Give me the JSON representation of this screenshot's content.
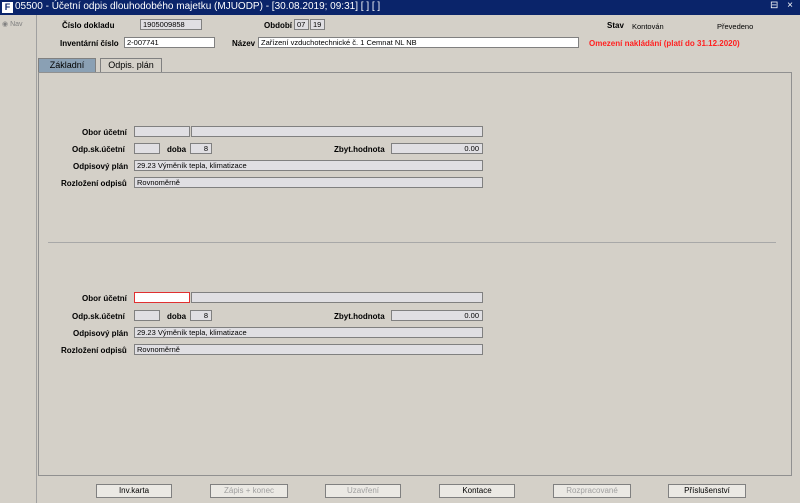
{
  "titlebar": {
    "icon": "F",
    "title": "05500 - Účetní odpis dlouhodobého majetku (MJUODP) - [30.08.2019; 09:31]  [ ]  [ ]",
    "controls": "⊟ ×"
  },
  "nav": {
    "label": "Nav"
  },
  "header": {
    "doc_number_label": "Číslo dokladu",
    "doc_number_value": "1905009858",
    "period_label": "Období",
    "period_month": "07",
    "period_year": "19",
    "state_label": "Stav",
    "state_value": "Kontován",
    "state_value2": "Převedeno",
    "inventory_label": "Inventární číslo",
    "inventory_value": "2-007741",
    "name_label": "Název",
    "name_value": "Zařízení vzduchotechnické č. 1 Cemnat NL NB",
    "restriction_text": "Omezení nakládání (platí do 31.12.2020)"
  },
  "tabs": [
    {
      "label": "Základní"
    },
    {
      "label": "Odpis. plán"
    }
  ],
  "sections": [
    {
      "obor_label": "Obor účetní",
      "obor_code": "",
      "obor_name": "",
      "odp_label": "Odp.sk.účetní",
      "odp_value": "",
      "doba_label": "doba",
      "doba_value": "8",
      "zbyt_label": "Zbyt.hodnota",
      "zbyt_value": "0.00",
      "plan_label": "Odpisový plán",
      "plan_value": "29.23 Výměník tepla, klimatizace",
      "rozlozeni_label": "Rozložení odpisů",
      "rozlozeni_value": "Rovnoměrně"
    },
    {
      "obor_label": "Obor účetní",
      "obor_code": "",
      "obor_name": "",
      "odp_label": "Odp.sk.účetní",
      "odp_value": "",
      "doba_label": "doba",
      "doba_value": "8",
      "zbyt_label": "Zbyt.hodnota",
      "zbyt_value": "0.00",
      "plan_label": "Odpisový plán",
      "plan_value": "29.23 Výměník tepla, klimatizace",
      "rozlozeni_label": "Rozložení odpisů",
      "rozlozeni_value": "Rovnoměrně"
    }
  ],
  "buttons": [
    {
      "label": "Inv.karta",
      "enabled": true
    },
    {
      "label": "Zápis + konec",
      "enabled": false
    },
    {
      "label": "Uzavření",
      "enabled": false
    },
    {
      "label": "Kontace",
      "enabled": true
    },
    {
      "label": "Rozpracované",
      "enabled": false
    },
    {
      "label": "Příslušenství",
      "enabled": true
    }
  ],
  "colors": {
    "titlebar": "#0a246a",
    "active_tab": "#8aa0b4",
    "warning": "#ff2020"
  }
}
